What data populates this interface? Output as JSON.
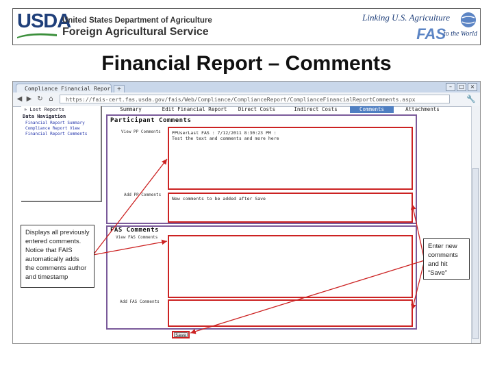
{
  "banner": {
    "usda": "USDA",
    "dept_line1": "United States Department of Agriculture",
    "dept_line2": "Foreign Agricultural Service",
    "linking": "Linking U.S. Agriculture",
    "fas": "FAS",
    "world": "to the World"
  },
  "slide_title": "Financial Report – Comments",
  "browser": {
    "tab_label": "Compliance Financial Report C",
    "new_tab": "+",
    "url": "https://fais-cert.fas.usda.gov/fais/Web/Compliance/ComplianceReport/ComplianceFinancialReportComments.aspx",
    "minimize": "–",
    "maximize": "□",
    "close": "×",
    "back": "◀",
    "forward": "▶",
    "reload": "↻",
    "home": "⌂",
    "wrench": "🔧"
  },
  "sidebar": {
    "items": [
      "» Lost Reports"
    ],
    "nav_title": "Data Navigation",
    "links": [
      "Financial Report Summary",
      "Compliance Report View",
      "Financial Report Comments"
    ]
  },
  "nav_tabs": [
    "Summary",
    "Edit Financial Report",
    "Direct Costs",
    "Indirect Costs",
    "Comments",
    "Attachments"
  ],
  "participant": {
    "title": "Participant Comments",
    "view_label": "View PP Comments",
    "view_text_line1": "PPUserLast FAS : 7/12/2011 8:30:23 PM :",
    "view_text_line2": "Test the text and comments and more here",
    "add_label": "Add PP Comments",
    "add_text": "New comments to be added after Save"
  },
  "fas": {
    "title": "FAS Comments",
    "view_label": "View FAS Comments",
    "add_label": "Add FAS Comments"
  },
  "save_label": "Save",
  "callout_left": "Displays all previously entered comments. Notice that FAIS automatically adds the comments author and timestamp",
  "callout_right": "Enter new comments and hit “Save”"
}
